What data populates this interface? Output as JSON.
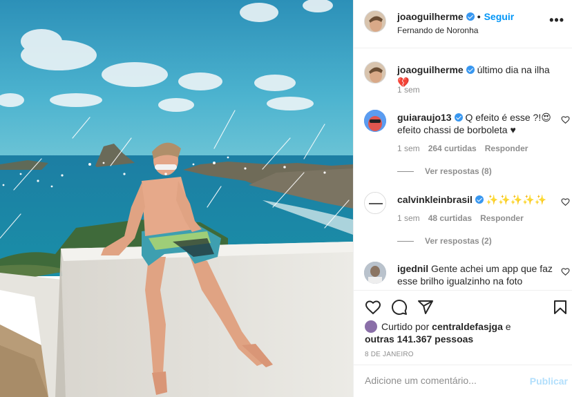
{
  "post": {
    "username": "joaoguilherme",
    "follow_label": "Seguir",
    "separator": "•",
    "location": "Fernando de Noronha",
    "more_label": "•••"
  },
  "caption": {
    "username": "joaoguilherme",
    "text": " último dia na ilha 💔",
    "time": "1 sem"
  },
  "comments": [
    {
      "username": "guiaraujo13",
      "text": " Q efeito é esse ?!😍 efeito chassi de borboleta ♥",
      "time": "1 sem",
      "likes": "264 curtidas",
      "reply": "Responder",
      "replies": "Ver respostas (8)"
    },
    {
      "username": "calvinkleinbrasil",
      "text": " ✨✨✨✨✨",
      "time": "1 sem",
      "likes": "48 curtidas",
      "reply": "Responder",
      "replies": "Ver respostas (2)"
    },
    {
      "username": "igednil",
      "text": " Gente achei um app que faz esse brilho igualzinho na foto"
    }
  ],
  "likes": {
    "prefix": "Curtido por ",
    "user": "centraldefasjga",
    "middle": " e",
    "count": "outras 141.367 pessoas"
  },
  "date": "8 DE JANEIRO",
  "add_comment": {
    "placeholder": "Adicione um comentário...",
    "publish_label": "Publicar"
  },
  "icons": {
    "like": "heart-icon",
    "comment": "comment-icon",
    "share": "share-icon",
    "save": "bookmark-icon",
    "more": "more-options-icon",
    "verified": "verified-badge-icon"
  },
  "colors": {
    "link": "#0095f6",
    "verified": "#3897f0",
    "muted": "#8e8e8e",
    "publish_disabled": "#b2dffc"
  }
}
